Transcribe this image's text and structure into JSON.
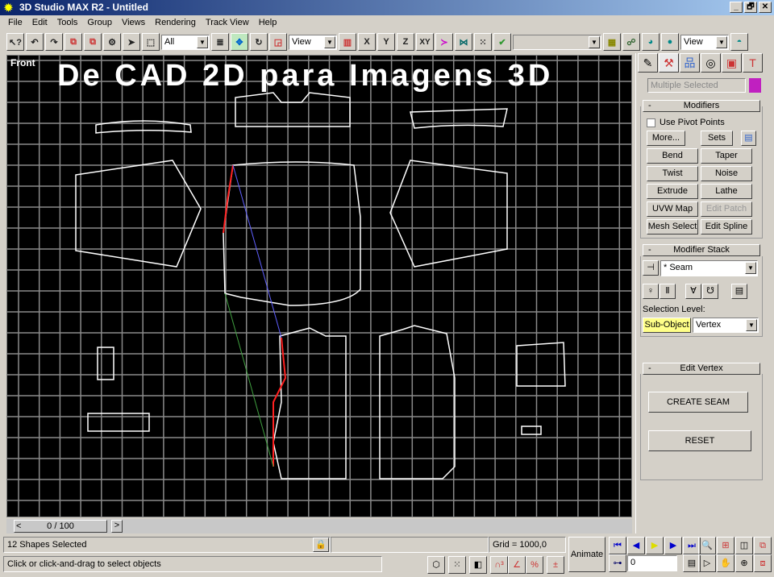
{
  "window": {
    "title": "3D Studio MAX R2 - Untitled",
    "controls": [
      "_",
      "🗗",
      "✕"
    ]
  },
  "menu": [
    "File",
    "Edit",
    "Tools",
    "Group",
    "Views",
    "Rendering",
    "Track View",
    "Help"
  ],
  "toolbar": {
    "filter_value": "All",
    "coord_value": "View",
    "axis": [
      "X",
      "Y",
      "Z",
      "XY"
    ],
    "named_sel_value": "",
    "render_value": "View"
  },
  "viewport": {
    "label": "Front",
    "overlay_title": "De CAD 2D para Imagens 3D",
    "grid_color": "#8a8a8a",
    "shape_color": "#ffffff",
    "seam_colors": [
      "#ff2020",
      "#6060ff",
      "#40a040"
    ]
  },
  "panel": {
    "tabs": [
      "create-icon",
      "modify-icon",
      "hierarchy-icon",
      "motion-icon",
      "display-icon",
      "utilities-icon"
    ],
    "name_value": "Multiple Selected",
    "object_color": "#c020c0",
    "modifiers": {
      "title": "Modifiers",
      "minus": "-",
      "use_pivot": "Use Pivot Points",
      "more": "More...",
      "sets": "Sets",
      "buttons": [
        "Bend",
        "Taper",
        "Twist",
        "Noise",
        "Extrude",
        "Lathe",
        "UVW Map",
        "Edit Patch",
        "Mesh Select",
        "Edit Spline"
      ]
    },
    "stack": {
      "title": "Modifier Stack",
      "minus": "-",
      "value": "* Seam",
      "selection_level": "Selection Level:",
      "sub_object": "Sub-Object",
      "level_value": "Vertex"
    },
    "edit_vertex": {
      "title": "Edit Vertex",
      "minus": "-",
      "create_seam": "CREATE SEAM",
      "reset": "RESET"
    }
  },
  "timeline": {
    "frame": "0 / 100",
    "prev": "<",
    "next": ">"
  },
  "status": {
    "selected": "12 Shapes Selected",
    "prompt": "Click or click-and-drag to select objects",
    "grid": "Grid = 1000,0",
    "animate": "Animate",
    "frame_value": "0"
  }
}
